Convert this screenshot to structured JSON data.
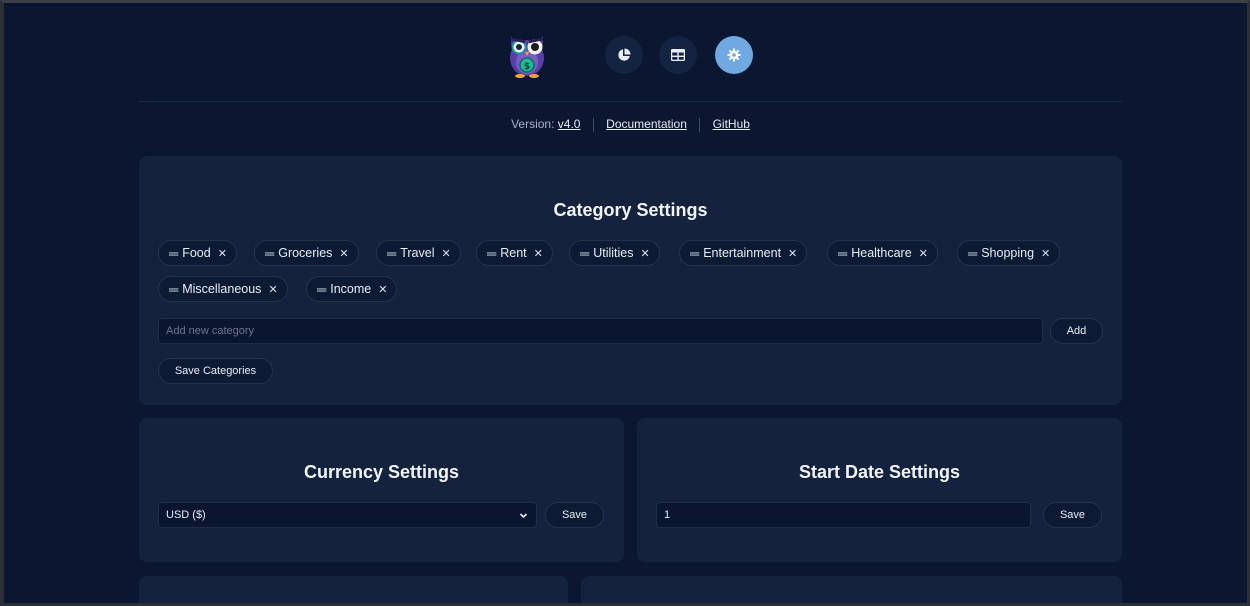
{
  "header": {
    "nav": [
      {
        "name": "charts",
        "icon": "pie-chart-icon",
        "active": false
      },
      {
        "name": "table",
        "icon": "table-icon",
        "active": false
      },
      {
        "name": "settings",
        "icon": "gear-icon",
        "active": true
      }
    ]
  },
  "version": {
    "label": "Version:",
    "value": "v4.0",
    "documentation": "Documentation",
    "github": "GitHub"
  },
  "categories": {
    "title": "Category Settings",
    "items": [
      {
        "label": "Food"
      },
      {
        "label": "Groceries"
      },
      {
        "label": "Travel"
      },
      {
        "label": "Rent"
      },
      {
        "label": "Utilities"
      },
      {
        "label": "Entertainment"
      },
      {
        "label": "Healthcare"
      },
      {
        "label": "Shopping"
      },
      {
        "label": "Miscellaneous"
      },
      {
        "label": "Income"
      }
    ],
    "placeholder": "Add new category",
    "add_label": "Add",
    "save_label": "Save Categories"
  },
  "currency": {
    "title": "Currency Settings",
    "selected": "USD ($)",
    "save_label": "Save"
  },
  "start_date": {
    "title": "Start Date Settings",
    "value": "1",
    "save_label": "Save"
  },
  "colors": {
    "background": "#0b1630",
    "card": "#14223d",
    "accent": "#6fa9e0"
  }
}
